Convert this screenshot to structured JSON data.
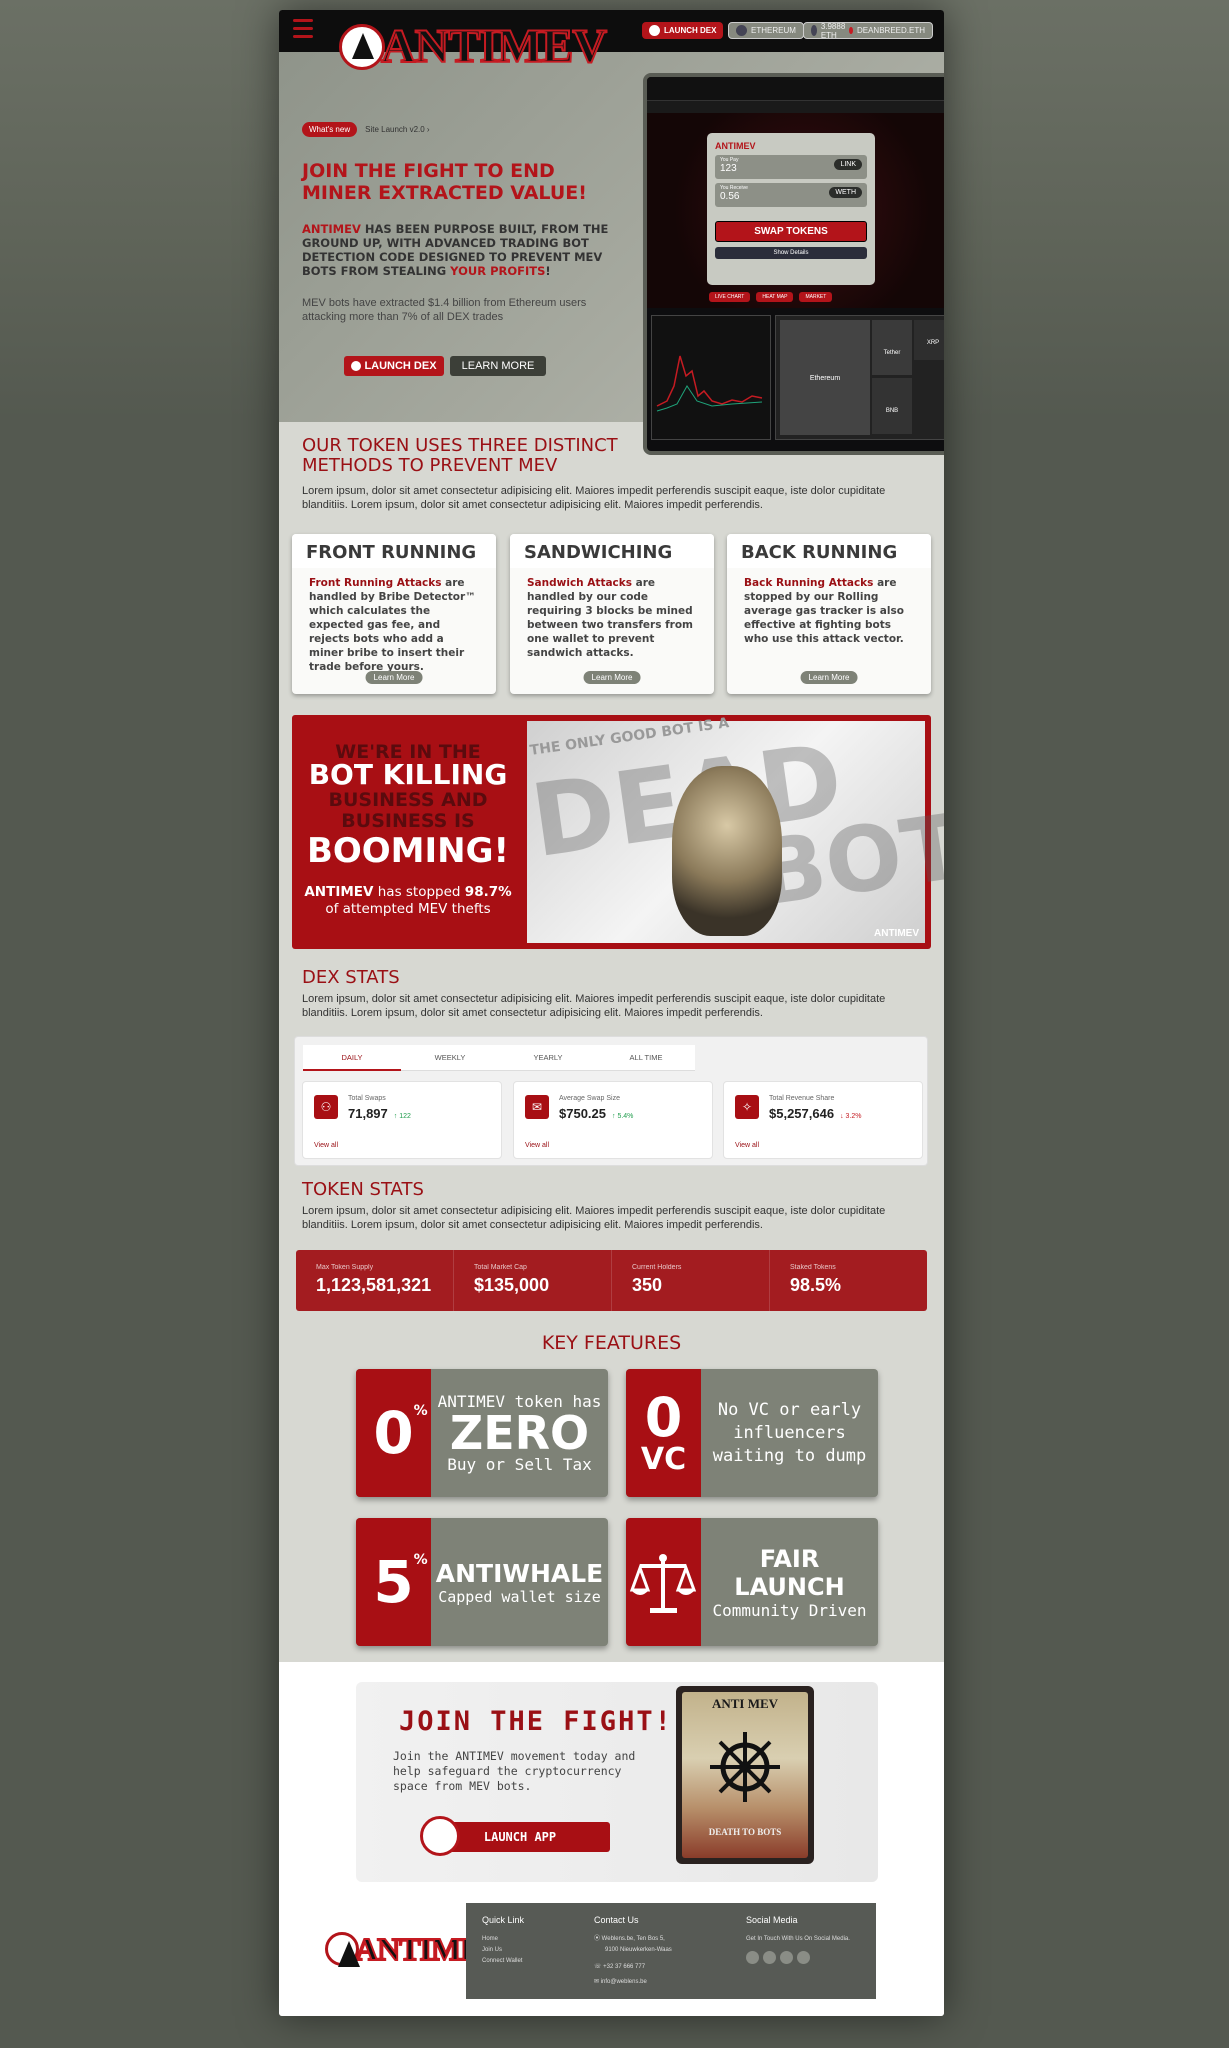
{
  "header": {
    "brand": "ANTIMEV",
    "launch_dex": "LAUNCH DEX",
    "network": "ETHEREUM",
    "balance": "3.9888 ETH",
    "wallet": "DEANBREED.ETH"
  },
  "hero": {
    "badge": "What's new",
    "badge_text": "Site Launch v2.0 ›",
    "headline": "JOIN THE FIGHT TO END MINER EXTRACTED VALUE!",
    "sub_brand": "ANTIMEV",
    "sub_text": " HAS BEEN PURPOSE BUILT, FROM THE GROUND UP, WITH ADVANCED TRADING BOT DETECTION CODE DESIGNED TO PREVENT MEV BOTS FROM STEALING ",
    "sub_highlight": "YOUR PROFITS",
    "sub_end": "!",
    "paragraph": "MEV bots have extracted $1.4 billion from Ethereum users attacking more than 7% of all DEX trades",
    "btn_launch": "LAUNCH DEX",
    "btn_learn": "LEARN MORE"
  },
  "mockup": {
    "swap_label": "SWAP TOKENS",
    "pay_label": "You Pay",
    "pay_value": "123",
    "pay_token": "LINK",
    "receive_label": "You Receive",
    "receive_value": "0.56",
    "receive_token": "WETH",
    "show_details": "Show Details",
    "live_chart": "LIVE CHART",
    "heat_map": "HEAT MAP",
    "market": "MARKET",
    "heat_eth": "Ethereum",
    "heat_tether": "Tether",
    "heat_bnb": "BNB",
    "heat_xrp": "XRP"
  },
  "methods": {
    "title": "OUR TOKEN USES THREE DISTINCT METHODS TO PREVENT MEV",
    "lorem": "Lorem ipsum, dolor sit amet consectetur adipisicing elit. Maiores impedit perferendis suscipit eaque, iste dolor cupiditate blanditiis. Lorem ipsum, dolor sit amet consectetur adipisicing elit. Maiores impedit perferendis.",
    "cards": [
      {
        "title": "FRONT RUNNING",
        "lead": "Front Running Attacks",
        "body": " are handled by Bribe Detector™ which calculates the expected gas fee, and rejects bots who add a miner bribe to insert their trade before yours.",
        "btn": "Learn More"
      },
      {
        "title": "SANDWICHING",
        "lead": "Sandwich Attacks",
        "body": " are handled by our code requiring 3 blocks be mined between two transfers from one wallet to prevent sandwich attacks.",
        "btn": "Learn More"
      },
      {
        "title": "BACK RUNNING",
        "lead": "Back Running Attacks",
        "body": " are stopped by our Rolling average gas tracker is also effective at fighting bots who use this attack vector.",
        "btn": "Learn More"
      }
    ]
  },
  "banner": {
    "line1": "WE'RE IN THE",
    "line2": "BOT KILLING",
    "line3": "BUSINESS AND",
    "line4": "BUSINESS IS",
    "line5": "BOOMING!",
    "brand": "ANTIMEV",
    "stopped": " has stopped ",
    "percent": "98.7%",
    "tail": "of attempted MEV thefts",
    "pic_top": "THE ONLY GOOD BOT IS A",
    "pic_dead": "DEAD",
    "pic_bot": "BOT",
    "pic_mark": "ANTIMEV"
  },
  "dex_stats": {
    "title": "DEX STATS",
    "lorem": "Lorem ipsum, dolor sit amet consectetur adipisicing elit. Maiores impedit perferendis suscipit eaque, iste dolor cupiditate blanditiis. Lorem ipsum, dolor sit amet consectetur adipisicing elit. Maiores impedit perferendis.",
    "tabs": [
      "DAILY",
      "WEEKLY",
      "YEARLY",
      "ALL TIME"
    ],
    "cards": [
      {
        "label": "Total Swaps",
        "value": "71,897",
        "delta": "↑ 122",
        "link": "View all",
        "delta_color": "#1f9d4c"
      },
      {
        "label": "Average Swap Size",
        "value": "$750.25",
        "delta": "↑ 5.4%",
        "link": "View all",
        "delta_color": "#1f9d4c"
      },
      {
        "label": "Total Revenue Share",
        "value": "$5,257,646",
        "delta": "↓ 3.2%",
        "link": "View all",
        "delta_color": "#c51b22"
      }
    ]
  },
  "token_stats": {
    "title": "TOKEN STATS",
    "lorem": "Lorem ipsum, dolor sit amet consectetur adipisicing elit. Maiores impedit perferendis suscipit eaque, iste dolor cupiditate blanditiis. Lorem ipsum, dolor sit amet consectetur adipisicing elit. Maiores impedit perferendis.",
    "items": [
      {
        "label": "Max Token Supply",
        "value": "1,123,581,321"
      },
      {
        "label": "Total Market Cap",
        "value": "$135,000"
      },
      {
        "label": "Current Holders",
        "value": "350"
      },
      {
        "label": "Staked Tokens",
        "value": "98.5%"
      }
    ]
  },
  "features": {
    "title": "KEY FEATURES",
    "f1_big": "0",
    "f1_sup": "%",
    "f1_l1": "ANTIMEV token has",
    "f1_l2": "ZERO",
    "f1_l3": "Buy or Sell Tax",
    "f2_big": "0",
    "f2_small": "VC",
    "f2_text": "No VC or early influencers waiting to dump",
    "f3_big": "5",
    "f3_sup": "%",
    "f3_l1": "ANTIWHALE",
    "f3_l2": "Capped wallet size",
    "f4_l1": "FAIR LAUNCH",
    "f4_l2": "Community Driven"
  },
  "join": {
    "title": "JOIN THE FIGHT!",
    "text": "Join the ANTIMEV movement today and help safeguard the cryptocurrency space from MEV bots.",
    "btn": "LAUNCH APP",
    "book_top": "ANTI MEV",
    "book_bottom": "DEATH TO BOTS"
  },
  "footer": {
    "brand": "ANTIMEV",
    "quick_title": "Quick Link",
    "quick": [
      "Home",
      "Join Us",
      "Connect Wallet"
    ],
    "contact_title": "Contact Us",
    "address1": "Weblens.be, Ten Bos 5,",
    "address2": "9100 Nieuwkerken-Waas",
    "phone": "+32 37 666 777",
    "email": "info@weblens.be",
    "social_title": "Social Media",
    "social_text": "Get In Touch With Us On Social Media."
  }
}
